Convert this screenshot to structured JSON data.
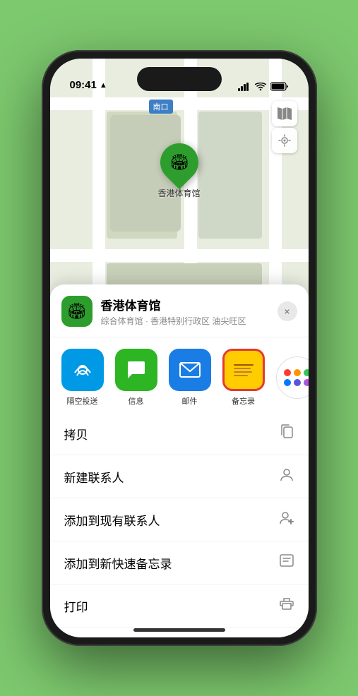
{
  "status_bar": {
    "time": "09:41",
    "location_arrow": "▲"
  },
  "map": {
    "label": "南口",
    "location_name": "香港体育馆",
    "pin_emoji": "🏟"
  },
  "location_header": {
    "name": "香港体育馆",
    "subtitle": "综合体育馆 · 香港特别行政区 油尖旺区",
    "close_label": "×"
  },
  "share_items": [
    {
      "id": "airdrop",
      "label": "隔空投送",
      "emoji": "📡"
    },
    {
      "id": "message",
      "label": "信息",
      "emoji": "💬"
    },
    {
      "id": "mail",
      "label": "邮件",
      "emoji": "✉️"
    },
    {
      "id": "notes",
      "label": "备忘录",
      "emoji": ""
    }
  ],
  "action_rows": [
    {
      "label": "拷贝",
      "icon": "📋"
    },
    {
      "label": "新建联系人",
      "icon": "👤"
    },
    {
      "label": "添加到现有联系人",
      "icon": "👤"
    },
    {
      "label": "添加到新快速备忘录",
      "icon": "🗒"
    },
    {
      "label": "打印",
      "icon": "🖨"
    }
  ],
  "dots": [
    {
      "color": "#ff3b30"
    },
    {
      "color": "#ff9500"
    },
    {
      "color": "#34c759"
    },
    {
      "color": "#007aff"
    },
    {
      "color": "#5856d6"
    },
    {
      "color": "#af52de"
    }
  ]
}
